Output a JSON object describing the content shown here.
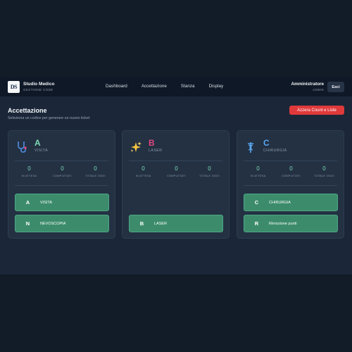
{
  "header": {
    "brand_logo": "DS",
    "brand_title": "Studio Medico",
    "brand_subtitle": "GESTIONE CODE",
    "nav": [
      "Dashboard",
      "Accettazione",
      "Stanza",
      "Display"
    ],
    "user_name": "Amministratore",
    "user_role": "ADMIN",
    "exit_label": "Esci"
  },
  "page": {
    "title": "Accettazione",
    "subtitle": "Seleziona un codice per generare un nuovo ticket",
    "reset_label": "Azzera Count e Liste"
  },
  "stat_labels": [
    "IN ATTESA",
    "COMPLETATI",
    "TOTALE OGGI"
  ],
  "cards": [
    {
      "letter": "A",
      "name": "VISITA",
      "icon": "stethoscope-icon",
      "letter_color": "#7fd9b4",
      "stats": [
        "0",
        "0",
        "0"
      ],
      "buttons": [
        {
          "code": "A",
          "label": "VISITA"
        },
        {
          "code": "N",
          "label": "NEVOSCOPIA"
        }
      ]
    },
    {
      "letter": "B",
      "name": "LASER",
      "icon": "sparkles-icon",
      "letter_color": "#e0467f",
      "stats": [
        "0",
        "0",
        "0"
      ],
      "buttons": [
        {
          "code": "B",
          "label": "LASER"
        }
      ]
    },
    {
      "letter": "C",
      "name": "CHIRURGIA",
      "icon": "medical-caduceus-icon",
      "letter_color": "#5aa7f0",
      "stats": [
        "0",
        "0",
        "0"
      ],
      "buttons": [
        {
          "code": "C",
          "label": "CHIRURGIA"
        },
        {
          "code": "R",
          "label": "Rimozione punti"
        }
      ]
    }
  ],
  "colors": {
    "accent_green": "#3c8c6c",
    "danger": "#e0393b",
    "background": "#1b2738"
  }
}
